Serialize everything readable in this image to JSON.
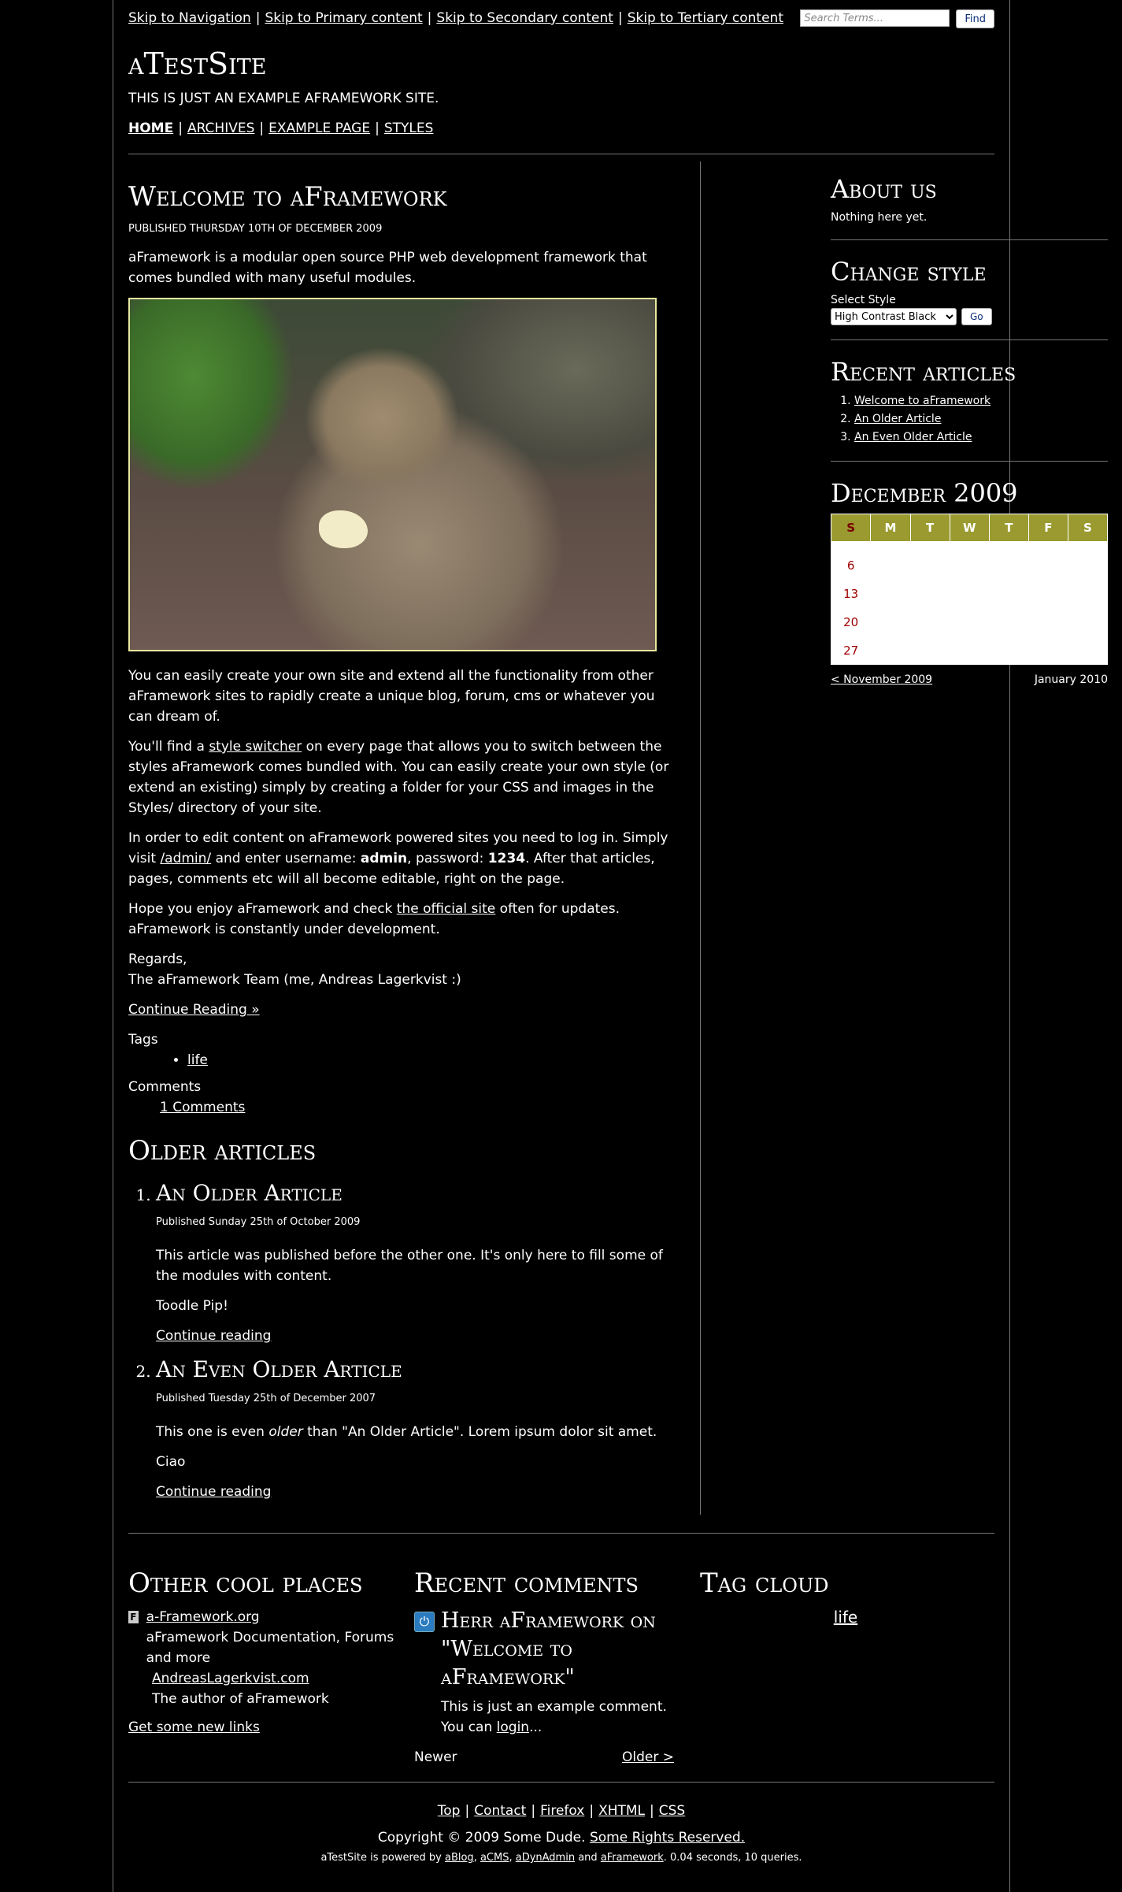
{
  "skip_links": [
    "Skip to Navigation",
    "Skip to Primary content",
    "Skip to Secondary content",
    "Skip to Tertiary content"
  ],
  "search": {
    "placeholder": "Search Terms...",
    "button": "Find"
  },
  "site": {
    "title": "aTestSite",
    "description": "This is just an example aFramework site."
  },
  "nav": [
    "Home",
    "Archives",
    "Example Page",
    "Styles"
  ],
  "article": {
    "title": "Welcome to aFramework",
    "published": "Published Thursday 10th of December 2009",
    "intro": "aFramework is a modular open source PHP web development framework that comes bundled with many useful modules.",
    "p1": "You can easily create your own site and extend all the functionality from other aFramework sites to rapidly create a unique blog, forum, cms or whatever you can dream of.",
    "p2_a": "You'll find a ",
    "p2_link": "style switcher",
    "p2_b": " on every page that allows you to switch between the styles aFramework comes bundled with. You can easily create your own style (or extend an existing) simply by creating a folder for your CSS and images in the Styles/ directory of your site.",
    "p3_a": "In order to edit content on aFramework powered sites you need to log in. Simply visit ",
    "p3_link": "/admin/",
    "p3_b": " and enter username: ",
    "p3_user": "admin",
    "p3_c": ", password: ",
    "p3_pass": "1234",
    "p3_d": ". After that articles, pages, comments etc will all become editable, right on the page.",
    "p4_a": "Hope you enjoy aFramework and check ",
    "p4_link": "the official site",
    "p4_b": " often for updates. aFramework is constantly under development.",
    "regards": "Regards,",
    "signoff": "The aFramework Team (me, Andreas Lagerkvist :)",
    "continue": "Continue Reading »",
    "tags_label": "Tags",
    "tags": [
      "life"
    ],
    "comments_label": "Comments",
    "comments_link": "1 Comments"
  },
  "older": {
    "heading": "Older articles",
    "items": [
      {
        "title": "An Older Article",
        "published": "Published Sunday 25th of October 2009",
        "p1": "This article was published before the other one. It's only here to fill some of the modules with content.",
        "p2": "Toodle Pip!",
        "link": "Continue reading"
      },
      {
        "title": "An Even Older Article",
        "published": "Published Tuesday 25th of December 2007",
        "p1_a": "This one is even ",
        "p1_em": "older",
        "p1_b": " than \"An Older Article\". Lorem ipsum dolor sit amet.",
        "p2": "Ciao",
        "link": "Continue reading"
      }
    ]
  },
  "sidebar": {
    "about": {
      "heading": "About us",
      "text": "Nothing here yet."
    },
    "style": {
      "heading": "Change style",
      "label": "Select Style",
      "selected": "High Contrast Black",
      "button": "Go"
    },
    "recent": {
      "heading": "Recent articles",
      "items": [
        "Welcome to aFramework",
        "An Older Article",
        "An Even Older Article"
      ]
    },
    "calendar": {
      "heading": "December 2009",
      "days": [
        "S",
        "M",
        "T",
        "W",
        "T",
        "F",
        "S"
      ],
      "rows": [
        [
          "",
          "",
          "",
          "",
          "",
          "",
          ""
        ],
        [
          "6",
          "",
          "",
          "",
          "",
          "",
          ""
        ],
        [
          "13",
          "",
          "",
          "",
          "",
          "",
          ""
        ],
        [
          "20",
          "",
          "",
          "",
          "",
          "",
          ""
        ],
        [
          "27",
          "",
          "",
          "",
          "",
          "",
          ""
        ]
      ],
      "prev": "< November 2009",
      "next": "January 2010"
    }
  },
  "footer": {
    "places": {
      "heading": "Other cool places",
      "items": [
        {
          "icon": "F",
          "link": "a-Framework.org",
          "desc": "aFramework Documentation, Forums and more"
        },
        {
          "link": "AndreasLagerkvist.com",
          "desc": "The author of aFramework"
        }
      ],
      "more": "Get some new links"
    },
    "comments": {
      "heading": "Recent comments",
      "title": "Herr aFramework on \"Welcome to aFramework\"",
      "text_a": "This is just an example comment. You can ",
      "text_link": "login",
      "text_b": "...",
      "newer": "Newer",
      "older": "Older >"
    },
    "tagcloud": {
      "heading": "Tag cloud",
      "tags": [
        "life"
      ]
    },
    "bottom_links": [
      "Top",
      "Contact",
      "Firefox",
      "XHTML",
      "CSS"
    ],
    "copyright_a": "Copyright © 2009 Some Dude. ",
    "copyright_link": "Some Rights Reserved.",
    "powered_a": "aTestSite is powered by ",
    "powered_links": [
      "aBlog",
      "aCMS",
      "aDynAdmin",
      "aFramework"
    ],
    "powered_b": ". 0.04 seconds, 10 queries."
  }
}
